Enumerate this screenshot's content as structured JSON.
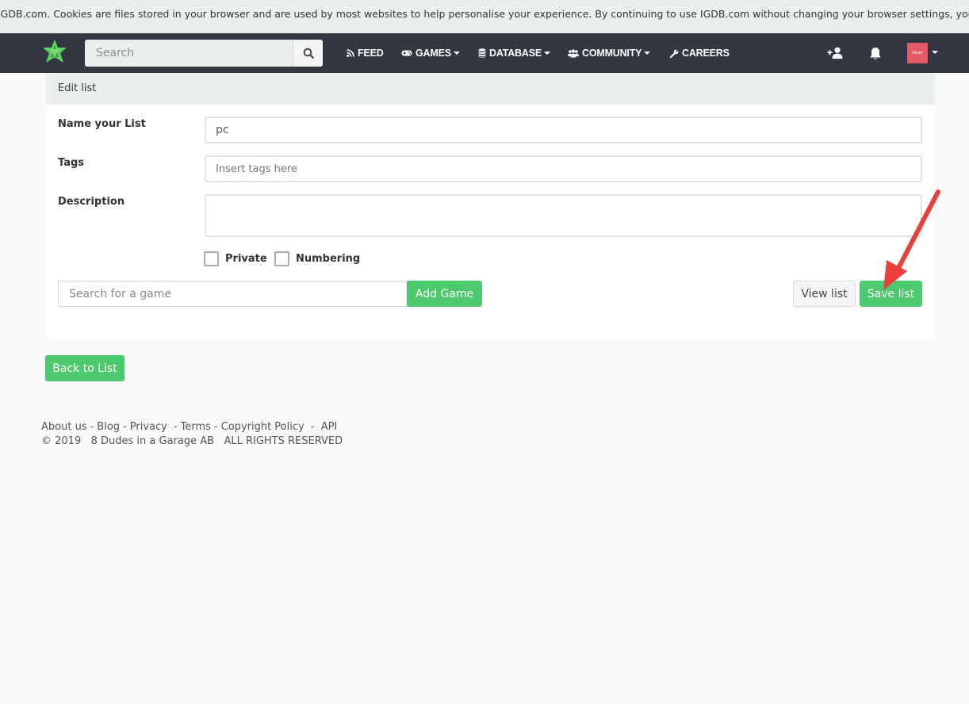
{
  "cookie_bar": {
    "text": "IGDB.com. Cookies are files stored in your browser and are used by most websites to help personalise your experience. By continuing to use IGDB.com without changing your browser settings, you are agreeing to our use"
  },
  "navbar": {
    "search_placeholder": "Search",
    "items": [
      {
        "label": "FEED",
        "icon": "rss-icon"
      },
      {
        "label": "GAMES",
        "icon": "gamepad-icon"
      },
      {
        "label": "DATABASE",
        "icon": "database-icon"
      },
      {
        "label": "COMMUNITY",
        "icon": "users-icon"
      },
      {
        "label": "CAREERS",
        "icon": "wrench-icon"
      }
    ],
    "avatar_text": "Heart"
  },
  "panel": {
    "header": "Edit list",
    "name_label": "Name your List",
    "name_value": "pc",
    "tags_label": "Tags",
    "tags_placeholder": "Insert tags here",
    "description_label": "Description",
    "description_value": "",
    "private_label": "Private",
    "numbering_label": "Numbering",
    "game_search_placeholder": "Search for a game",
    "add_game_label": "Add Game",
    "view_list_label": "View list",
    "save_list_label": "Save list"
  },
  "back_to_list_label": "Back to List",
  "footer": {
    "links": [
      "About us",
      "Blog",
      "Privacy",
      "Terms",
      "Copyright Policy",
      "API"
    ],
    "copyright": "© 2019   8 Dudes in a Garage AB   ALL RIGHTS RESERVED"
  },
  "colors": {
    "navbar": "#323741",
    "accent_green": "#4cca6d",
    "annotation_arrow": "#e8413c"
  }
}
